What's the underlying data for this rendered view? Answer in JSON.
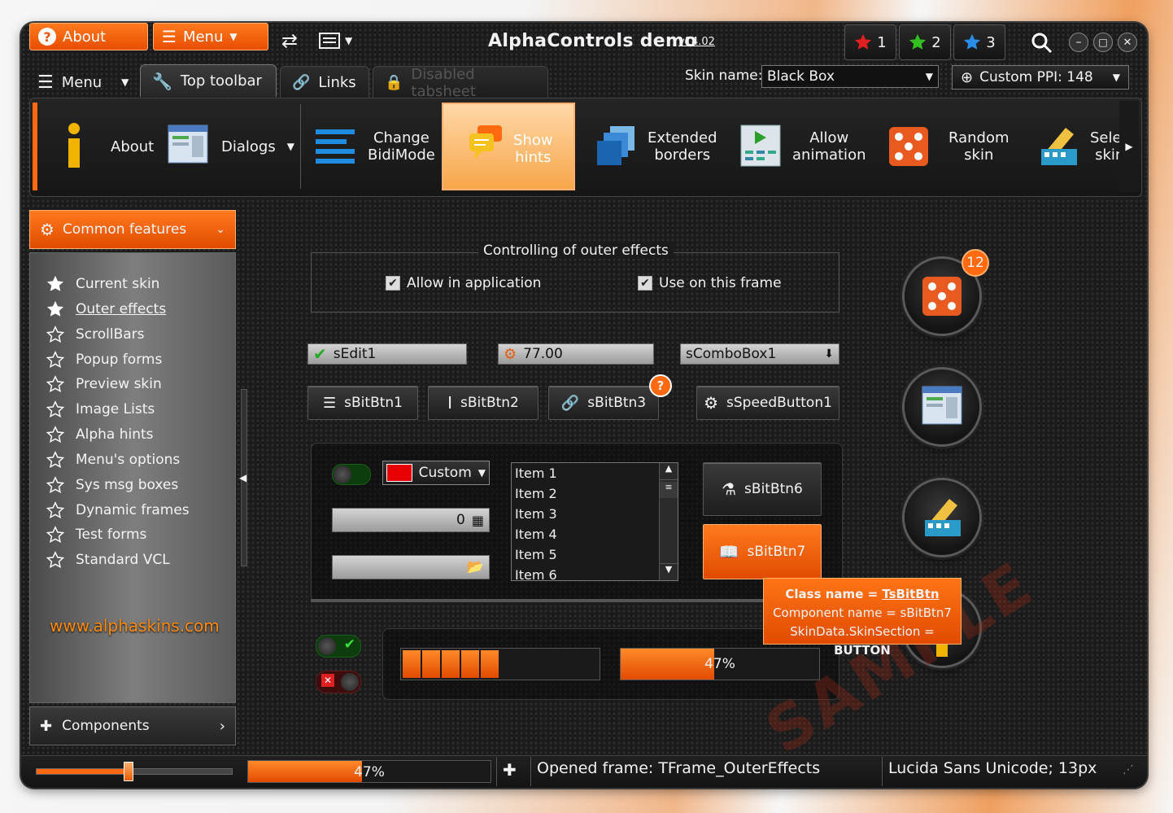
{
  "title_bar": {
    "about_label": "About",
    "menu_label": "Menu",
    "app_title": "AlphaControls demo",
    "version": "v14.02",
    "tab1": "1",
    "tab2": "2",
    "tab3": "3"
  },
  "second_bar": {
    "menu_label": "Menu",
    "tabs": [
      "Top toolbar",
      "Links",
      "Disabled tabsheet"
    ],
    "skin_label": "Skin name:",
    "skin_value": "Black Box",
    "ppi_label": "Custom PPI: 148"
  },
  "toolbar": {
    "about": "About",
    "dialogs": "Dialogs",
    "bidimode": [
      "Change",
      "BidiMode"
    ],
    "hints": [
      "Show",
      "hints"
    ],
    "borders": [
      "Extended",
      "borders"
    ],
    "animation": [
      "Allow",
      "animation"
    ],
    "random": [
      "Random",
      "skin"
    ],
    "select": [
      "Selec",
      "skin"
    ]
  },
  "sidebar": {
    "header": "Common features",
    "items": [
      "Current skin",
      "Outer effects",
      "ScrollBars",
      "Popup forms",
      "Preview skin",
      "Image Lists",
      "Alpha hints",
      "Menu's options",
      "Sys msg boxes",
      "Dynamic frames",
      "Test forms",
      "Standard VCL"
    ],
    "link": "www.alphaskins.com",
    "components": "Components"
  },
  "main": {
    "group_title": "Controlling of outer effects",
    "check1": "Allow in application",
    "check2": "Use on this frame",
    "edit1": "sEdit1",
    "spin": "77.00",
    "combo": "sComboBox1",
    "btn1": "sBitBtn1",
    "btn2": "sBitBtn2",
    "btn3": "sBitBtn3",
    "speed": "sSpeedButton1",
    "color_combo": "Custom",
    "calc_value": "0",
    "list_items": [
      "Item 1",
      "Item 2",
      "Item 3",
      "Item 4",
      "Item 5",
      "Item 6"
    ],
    "btn6": "sBitBtn6",
    "btn7": "sBitBtn7",
    "progress2_label": "47%",
    "progress2_value": 0.47,
    "progress1_segments": 5,
    "badge": "12",
    "hint_badge": "?"
  },
  "hint": {
    "line1_label": "Class name = ",
    "line1_value": "TsBitBtn",
    "line2": "Component name = sBitBtn7",
    "line3_label": "SkinData.SkinSection = ",
    "line3_value": "BUTTON"
  },
  "watermark": "SAMPLE",
  "status": {
    "progress_label": "47%",
    "progress_value": 0.47,
    "slider_value": 0.47,
    "message": "Opened frame: TFrame_OuterEffects",
    "font": "Lucida Sans Unicode; 13px"
  },
  "colors": {
    "accent": "#ff6a10",
    "dark": "#1b1b1b"
  }
}
